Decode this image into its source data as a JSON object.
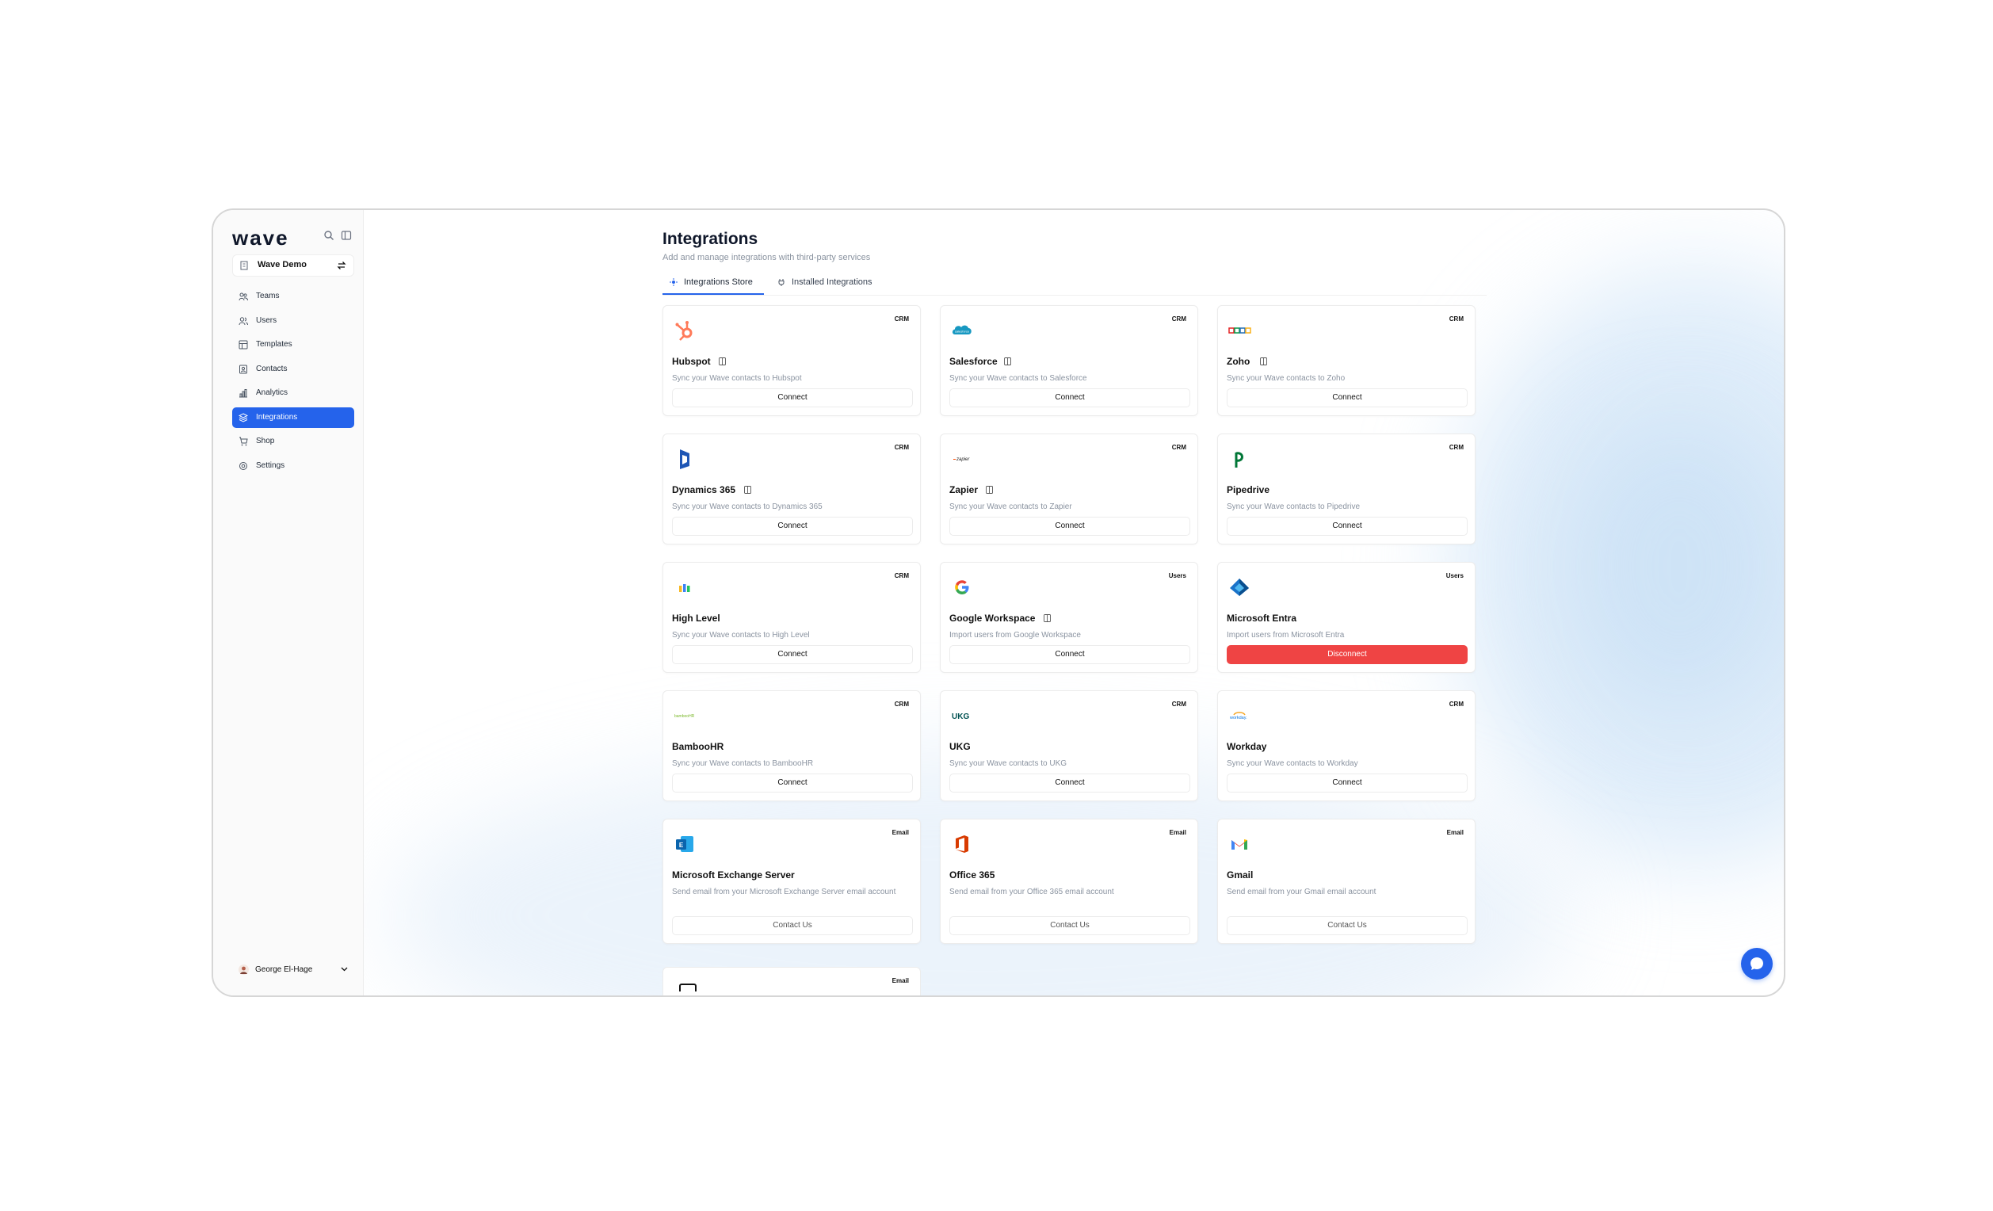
{
  "app": {
    "logo": "wave"
  },
  "sidebar": {
    "workspace": "Wave Demo",
    "items": [
      {
        "label": "Teams",
        "icon": "teams-icon"
      },
      {
        "label": "Users",
        "icon": "users-icon"
      },
      {
        "label": "Templates",
        "icon": "templates-icon"
      },
      {
        "label": "Contacts",
        "icon": "contacts-icon"
      },
      {
        "label": "Analytics",
        "icon": "analytics-icon"
      },
      {
        "label": "Integrations",
        "icon": "integrations-icon",
        "active": true
      },
      {
        "label": "Shop",
        "icon": "shop-icon"
      },
      {
        "label": "Settings",
        "icon": "settings-icon"
      }
    ],
    "user": {
      "name": "George El-Hage"
    }
  },
  "header": {
    "title": "Integrations",
    "subtitle": "Add and manage integrations with third-party services",
    "tabs": [
      {
        "label": "Integrations Store",
        "active": true
      },
      {
        "label": "Installed Integrations",
        "active": false
      }
    ]
  },
  "cards": [
    {
      "name": "Hubspot",
      "tag": "CRM",
      "desc": "Sync your Wave contacts to Hubspot",
      "action": "Connect",
      "icon": "hubspot-logo",
      "has_doc": true
    },
    {
      "name": "Salesforce",
      "tag": "CRM",
      "desc": "Sync your Wave contacts to Salesforce",
      "action": "Connect",
      "icon": "salesforce-logo",
      "has_doc": true
    },
    {
      "name": "Zoho",
      "tag": "CRM",
      "desc": "Sync your Wave contacts to Zoho",
      "action": "Connect",
      "icon": "zoho-logo",
      "has_doc": true
    },
    {
      "name": "Dynamics 365",
      "tag": "CRM",
      "desc": "Sync your Wave contacts to Dynamics 365",
      "action": "Connect",
      "icon": "dynamics-logo",
      "has_doc": true
    },
    {
      "name": "Zapier",
      "tag": "CRM",
      "desc": "Sync your Wave contacts to Zapier",
      "action": "Connect",
      "icon": "zapier-logo",
      "has_doc": true
    },
    {
      "name": "Pipedrive",
      "tag": "CRM",
      "desc": "Sync your Wave contacts to Pipedrive",
      "action": "Connect",
      "icon": "pipedrive-logo",
      "has_doc": false
    },
    {
      "name": "High Level",
      "tag": "CRM",
      "desc": "Sync your Wave contacts to High Level",
      "action": "Connect",
      "icon": "highlevel-logo",
      "has_doc": false
    },
    {
      "name": "Google Workspace",
      "tag": "Users",
      "desc": "Import users from Google Workspace",
      "action": "Connect",
      "icon": "google-logo",
      "has_doc": true
    },
    {
      "name": "Microsoft Entra",
      "tag": "Users",
      "desc": "Import users from Microsoft Entra",
      "action": "Disconnect",
      "icon": "entra-logo",
      "has_doc": false
    },
    {
      "name": "BambooHR",
      "tag": "CRM",
      "desc": "Sync your Wave contacts to BambooHR",
      "action": "Connect",
      "icon": "bamboohr-logo",
      "has_doc": false
    },
    {
      "name": "UKG",
      "tag": "CRM",
      "desc": "Sync your Wave contacts to UKG",
      "action": "Connect",
      "icon": "ukg-logo",
      "has_doc": false
    },
    {
      "name": "Workday",
      "tag": "CRM",
      "desc": "Sync your Wave contacts to Workday",
      "action": "Connect",
      "icon": "workday-logo",
      "has_doc": false
    },
    {
      "name": "Microsoft Exchange Server",
      "tag": "Email",
      "desc": "Send email from your Microsoft Exchange Server email account",
      "action": "Contact Us",
      "icon": "exchange-logo",
      "has_doc": false
    },
    {
      "name": "Office 365",
      "tag": "Email",
      "desc": "Send email from your Office 365 email account",
      "action": "Contact Us",
      "icon": "office365-logo",
      "has_doc": false
    },
    {
      "name": "Gmail",
      "tag": "Email",
      "desc": "Send email from your Gmail email account",
      "action": "Contact Us",
      "icon": "gmail-logo",
      "has_doc": false
    }
  ],
  "partial_card": {
    "tag": "Email"
  },
  "colors": {
    "accent": "#2563eb",
    "danger": "#ef4444",
    "muted_text": "#8a93a0"
  }
}
